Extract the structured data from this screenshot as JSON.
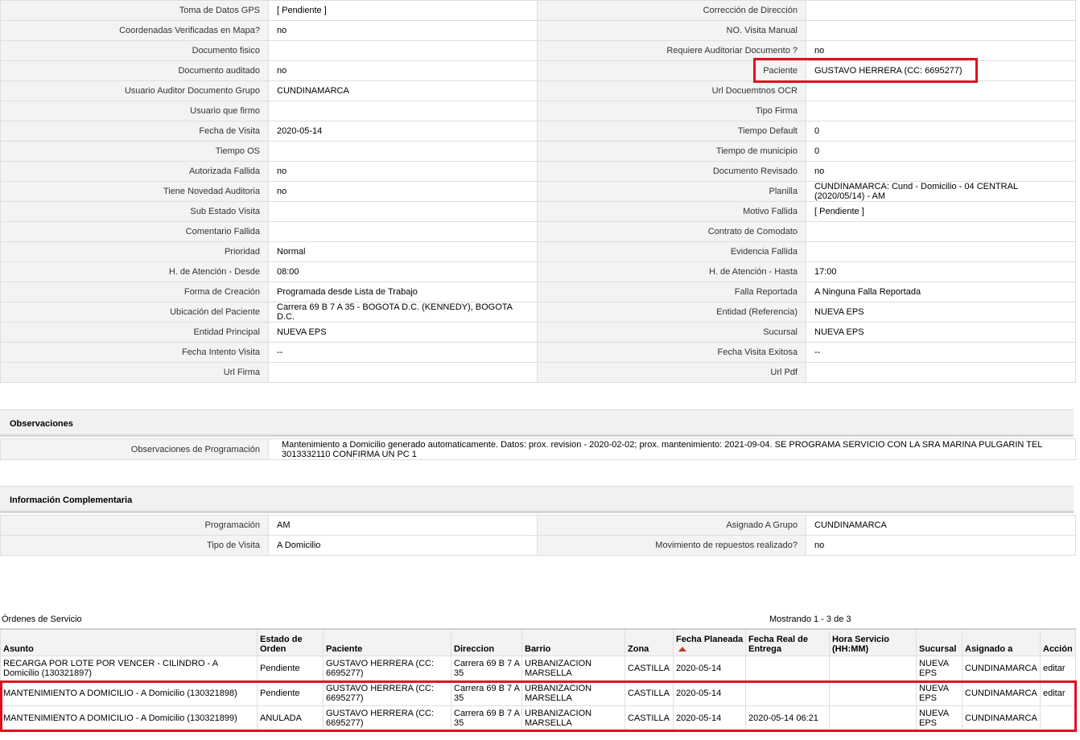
{
  "details": {
    "rows": [
      {
        "l1": "Toma de Datos GPS",
        "v1": "[ Pendiente ]",
        "l2": "Corrección de Dirección",
        "v2": ""
      },
      {
        "l1": "Coordenadas Verificadas en Mapa?",
        "v1": "no",
        "l2": "NO. Visita Manual",
        "v2": ""
      },
      {
        "l1": "Documento fisico",
        "v1": "",
        "l2": "Requiere Auditoriar Documento ?",
        "v2": "no"
      },
      {
        "l1": "Documento auditado",
        "v1": "no",
        "l2": "Paciente",
        "v2": "GUSTAVO HERRERA (CC: 6695277)"
      },
      {
        "l1": "Usuario Auditor Documento Grupo",
        "v1": "CUNDINAMARCA",
        "l2": "Url Docuemtnos OCR",
        "v2": ""
      },
      {
        "l1": "Usuario que firmo",
        "v1": "",
        "l2": "Tipo Firma",
        "v2": ""
      },
      {
        "l1": "Fecha de Visita",
        "v1": "2020-05-14",
        "l2": "Tiempo Default",
        "v2": "0"
      },
      {
        "l1": "Tiempo OS",
        "v1": "",
        "l2": "Tiempo de municipio",
        "v2": "0"
      },
      {
        "l1": "Autorizada Fallida",
        "v1": "no",
        "l2": "Documento Revisado",
        "v2": "no"
      },
      {
        "l1": "Tiene Novedad Auditoria",
        "v1": "no",
        "l2": "Planilla",
        "v2": "CUNDINAMARCA: Cund - Domicilio - 04 CENTRAL (2020/05/14) - AM"
      },
      {
        "l1": "Sub Estado Visita",
        "v1": "",
        "l2": "Motivo Fallida",
        "v2": "[ Pendiente ]"
      },
      {
        "l1": "Comentario Fallida",
        "v1": "",
        "l2": "Contrato de Comodato",
        "v2": ""
      },
      {
        "l1": "Prioridad",
        "v1": "Normal",
        "l2": "Evidencia Fallida",
        "v2": ""
      },
      {
        "l1": "H. de Atención - Desde",
        "v1": "08:00",
        "l2": "H. de Atención - Hasta",
        "v2": "17:00"
      },
      {
        "l1": "Forma de Creación",
        "v1": "Programada desde Lista de Trabajo",
        "l2": "Falla Reportada",
        "v2": "A Ninguna Falla Reportada"
      },
      {
        "l1": "Ubicación del Paciente",
        "v1": "Carrera 69 B 7 A 35 - BOGOTA D.C. (KENNEDY), BOGOTA D.C.",
        "l2": "Entidad (Referencia)",
        "v2": "NUEVA EPS"
      },
      {
        "l1": "Entidad Principal",
        "v1": "NUEVA EPS",
        "l2": "Sucursal",
        "v2": "NUEVA EPS"
      },
      {
        "l1": "Fecha Intento Visita",
        "v1": "--",
        "l2": "Fecha Visita Exitosa",
        "v2": "--"
      },
      {
        "l1": "Url Firma",
        "v1": "",
        "l2": "Url Pdf",
        "v2": ""
      }
    ]
  },
  "observaciones": {
    "title": "Observaciones",
    "label": "Observaciones de Programación",
    "value": "Mantenimiento a Domicilio generado automaticamente. Datos: prox. revision - 2020-02-02; prox. mantenimiento: 2021-09-04. SE PROGRAMA SERVICIO CON LA SRA MARINA PULGARIN TEL 3013332110 CONFIRMA UN PC 1"
  },
  "complementaria": {
    "title": "Información Complementaria",
    "rows": [
      {
        "l1": "Programación",
        "v1": "AM",
        "l2": "Asignado A Grupo",
        "v2": "CUNDINAMARCA"
      },
      {
        "l1": "Tipo de Visita",
        "v1": "A Domicilio",
        "l2": "Movimiento de repuestos realizado?",
        "v2": "no"
      }
    ]
  },
  "ordenes": {
    "title": "Órdenes de Servicio",
    "count": "Mostrando 1 - 3 de 3",
    "columns": [
      "Asunto",
      "Estado de Orden",
      "Paciente",
      "Direccion",
      "Barrio",
      "Zona",
      "Fecha Planeada",
      "Fecha Real de Entrega",
      "Hora Servicio (HH:MM)",
      "Sucursal",
      "Asignado a",
      "Acción"
    ],
    "rows": [
      {
        "asunto": "RECARGA POR LOTE POR VENCER - CILINDRO - A Domicilio (130321897)",
        "estado": "Pendiente",
        "paciente": "GUSTAVO HERRERA (CC: 6695277)",
        "direccion": "Carrera 69 B 7 A 35",
        "barrio": "URBANIZACION MARSELLA",
        "zona": "CASTILLA",
        "fecha_planeada": "2020-05-14",
        "fecha_real": "",
        "hora": "",
        "sucursal": "NUEVA EPS",
        "asignado": "CUNDINAMARCA",
        "accion": "editar"
      },
      {
        "asunto": "MANTENIMIENTO A DOMICILIO - A Domicilio (130321898)",
        "estado": "Pendiente",
        "paciente": "GUSTAVO HERRERA (CC: 6695277)",
        "direccion": "Carrera 69 B 7 A 35",
        "barrio": "URBANIZACION MARSELLA",
        "zona": "CASTILLA",
        "fecha_planeada": "2020-05-14",
        "fecha_real": "",
        "hora": "",
        "sucursal": "NUEVA EPS",
        "asignado": "CUNDINAMARCA",
        "accion": "editar"
      },
      {
        "asunto": "MANTENIMIENTO A DOMICILIO - A Domicilio (130321899)",
        "estado": "ANULADA",
        "paciente": "GUSTAVO HERRERA (CC: 6695277)",
        "direccion": "Carrera 69 B 7 A 35",
        "barrio": "URBANIZACION MARSELLA",
        "zona": "CASTILLA",
        "fecha_planeada": "2020-05-14",
        "fecha_real": "2020-05-14 06:21",
        "hora": "",
        "sucursal": "NUEVA EPS",
        "asignado": "CUNDINAMARCA",
        "accion": ""
      }
    ]
  },
  "colors": {
    "highlight": "#e0101c",
    "sort_arrow": "#c0392b"
  }
}
